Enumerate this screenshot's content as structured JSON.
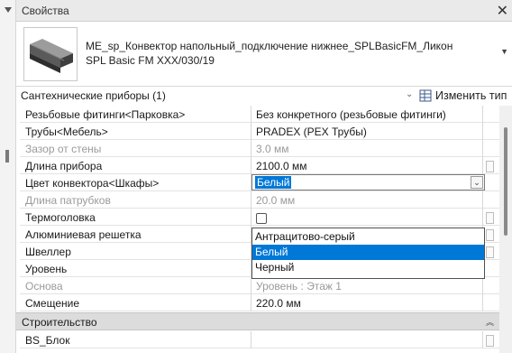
{
  "panel": {
    "title": "Свойства",
    "close_glyph": "✕",
    "pin_icon": "pin-icon"
  },
  "family": {
    "line1": "ME_sp_Конвектор напольный_подключение нижнее_SPLBasicFM_Ликон",
    "line2": "SPL Basic FM XXX/030/19"
  },
  "type_selector": {
    "label": "Сантехнические приборы (1)",
    "edit_type_label": "Изменить тип"
  },
  "rows": [
    {
      "name": "Резьбовые фитинги<Парковка>",
      "value": "Без конкретного (резьбовые фитинги)",
      "disabled": false
    },
    {
      "name": "Трубы<Мебель>",
      "value": "PRADEX (PEX Трубы)",
      "disabled": false
    },
    {
      "name": "Зазор от стены",
      "value": "3.0 мм",
      "disabled": true
    },
    {
      "name": "Длина прибора",
      "value": "2100.0 мм",
      "disabled": false
    },
    {
      "name": "Цвет конвектора<Шкафы>",
      "value": "Белый",
      "disabled": false
    },
    {
      "name": "Длина патрубков",
      "value": "20.0 мм",
      "disabled": true
    },
    {
      "name": "Термоголовка",
      "value": "",
      "disabled": false
    },
    {
      "name": "Алюминиевая решетка",
      "value": "",
      "disabled": false
    },
    {
      "name": "Швеллер",
      "value": "",
      "disabled": false
    },
    {
      "name": "Уровень",
      "value": "",
      "disabled": false
    },
    {
      "name": "Основа",
      "value": "Уровень : Этаж 1",
      "disabled": true
    },
    {
      "name": "Смещение",
      "value": "220.0 мм",
      "disabled": false
    }
  ],
  "section": {
    "label": "Строительство"
  },
  "rows_after": [
    {
      "name": "BS_Блок",
      "value": ""
    }
  ],
  "dropdown": {
    "selected_value": "Белый",
    "options": [
      "Антрацитово-серый",
      "Белый",
      "Черный"
    ],
    "selected_index": 1
  },
  "colors": {
    "selection": "#0078d7",
    "section_bg": "#dcdcdc",
    "disabled_text": "#9a9a9a"
  }
}
